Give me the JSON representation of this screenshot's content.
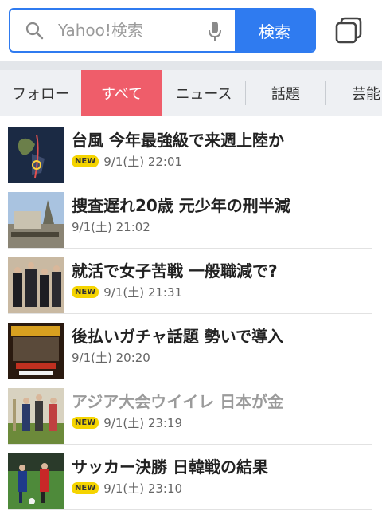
{
  "search": {
    "placeholder": "Yahoo!検索",
    "button_label": "検索"
  },
  "icons": {
    "search": "search-icon",
    "mic": "microphone-icon",
    "tabs": "tabs-icon"
  },
  "colors": {
    "accent": "#2f7bf0",
    "active_tab": "#ef5d6a",
    "new_badge": "#f5d400"
  },
  "categories": [
    {
      "label": "フォロー",
      "active": false
    },
    {
      "label": "すべて",
      "active": true
    },
    {
      "label": "ニュース",
      "active": false
    },
    {
      "label": "話題",
      "active": false
    },
    {
      "label": "芸能",
      "active": false
    }
  ],
  "news": [
    {
      "headline": "台風 今年最強級で来週上陸か",
      "time": "9/1(土) 22:01",
      "is_new": true,
      "read": false
    },
    {
      "headline": "捜査遅れ20歳 元少年の刑半減",
      "time": "9/1(土) 21:02",
      "is_new": false,
      "read": false
    },
    {
      "headline": "就活で女子苦戦 一般職減で?",
      "time": "9/1(土) 21:31",
      "is_new": true,
      "read": false
    },
    {
      "headline": "後払いガチャ話題 勢いで導入",
      "time": "9/1(土) 20:20",
      "is_new": false,
      "read": false
    },
    {
      "headline": "アジア大会ウイイレ 日本が金",
      "time": "9/1(土) 23:19",
      "is_new": true,
      "read": true
    },
    {
      "headline": "サッカー決勝 日韓戦の結果",
      "time": "9/1(土) 23:10",
      "is_new": true,
      "read": false
    }
  ],
  "new_label": "NEW"
}
